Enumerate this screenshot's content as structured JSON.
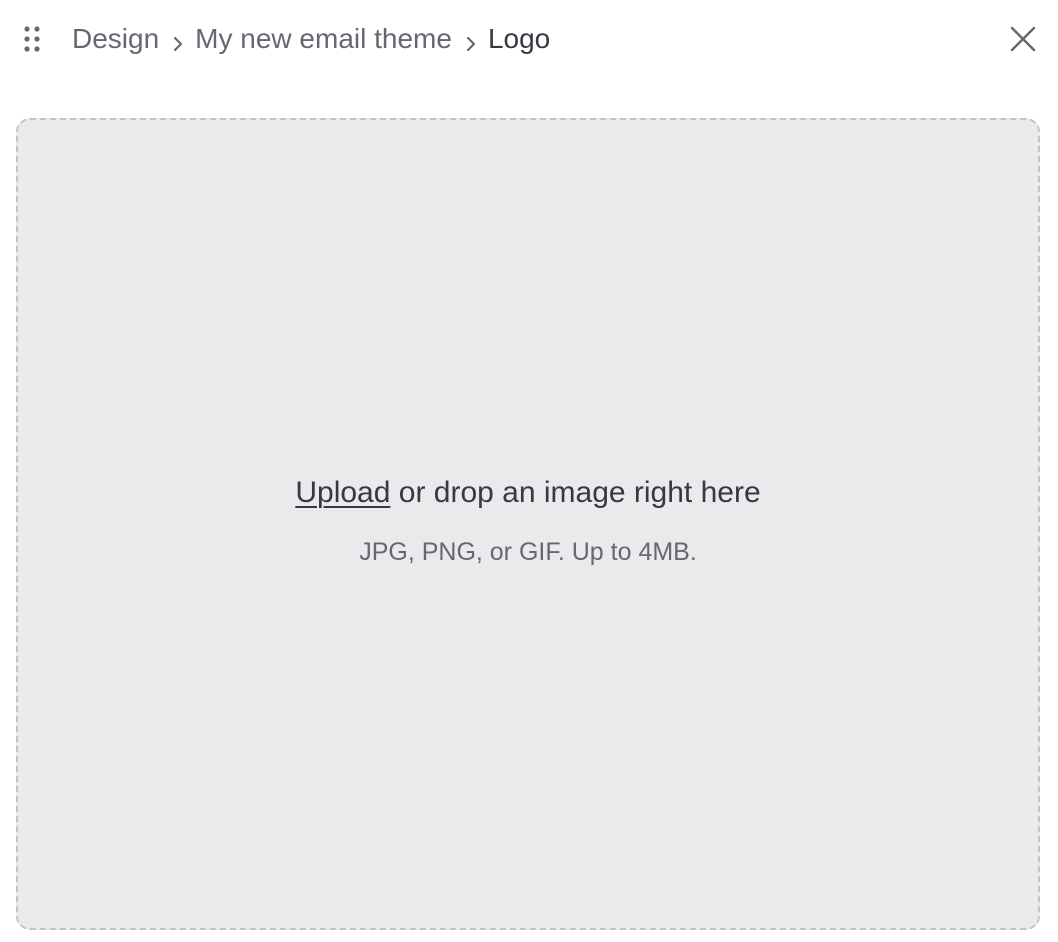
{
  "header": {
    "breadcrumb": [
      {
        "label": "Design"
      },
      {
        "label": "My new email theme"
      },
      {
        "label": "Logo"
      }
    ],
    "drag_icon": "drag-handle-icon",
    "close_icon": "close-icon"
  },
  "dropzone": {
    "upload_label": "Upload",
    "drop_text": " or drop an image right here",
    "hint": "JPG, PNG, or GIF. Up to 4MB."
  },
  "colors": {
    "text_primary": "#3d3540",
    "text_secondary": "#6b6570",
    "dropzone_bg": "#eaeaec",
    "dropzone_border": "#c4c2c7"
  }
}
